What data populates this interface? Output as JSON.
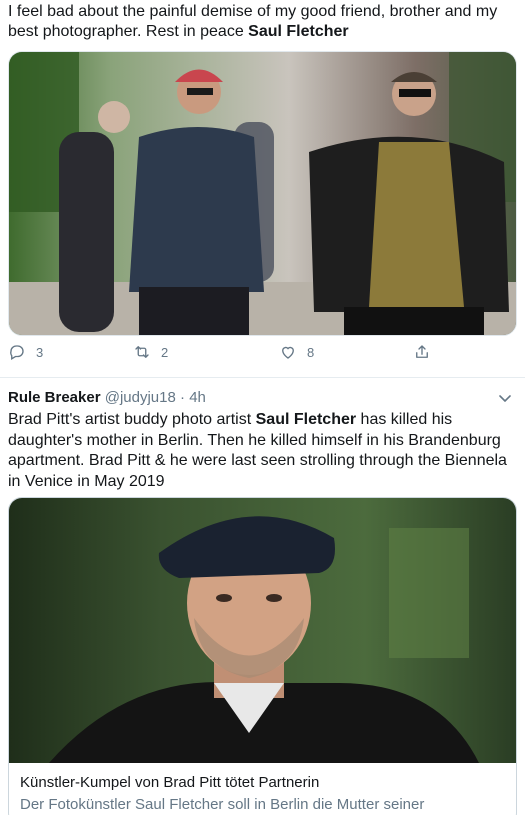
{
  "tweet1": {
    "text_line1": "I feel bad about the painful demise of my good friend, brother and my",
    "text_line2_prefix": "best photographer. Rest in peace ",
    "text_line2_bold": "Saul Fletcher",
    "photo_label": "Saul Fletcher and Brad Pitt walking on a street",
    "actions": {
      "replies": "3",
      "retweets": "2",
      "likes": "8"
    }
  },
  "tweet2": {
    "name": "Rule Breaker",
    "handle": "@judyju18",
    "separator": " · ",
    "time": "4h",
    "text_part1": "Brad Pitt's artist buddy photo artist ",
    "text_bold": "Saul Fletcher",
    "text_part2": " has killed his daughter's mother in Berlin. Then he killed himself in his Brandenburg apartment. Brad Pitt & he were last seen strolling through the Biennela in Venice in May 2019",
    "card": {
      "image_label": "Portrait of Brad Pitt in a flat cap",
      "title": "Künstler-Kumpel von Brad Pitt tötet Partnerin",
      "description": "Der Fotokünstler Saul Fletcher soll in Berlin die Mutter seiner"
    }
  },
  "colors": {
    "text": "#14171a",
    "secondary": "#657786",
    "border": "#ccd6dd",
    "divider": "#e6ecf0"
  }
}
